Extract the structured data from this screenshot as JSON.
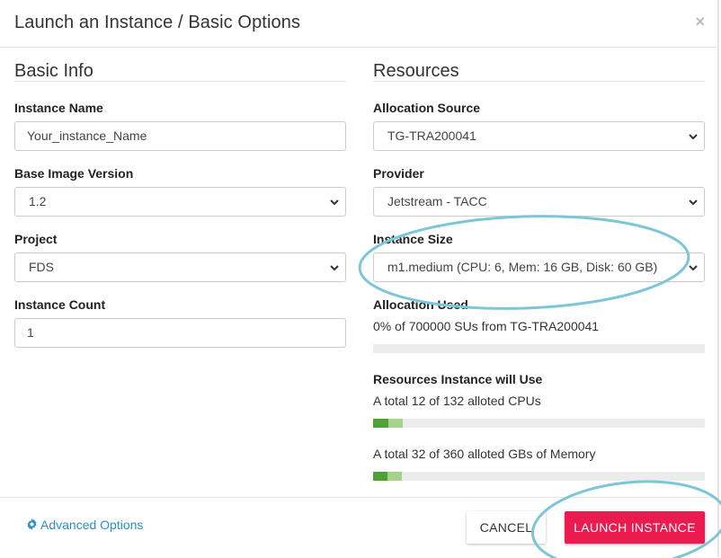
{
  "dialog": {
    "title": "Launch an Instance / Basic Options",
    "close_glyph": "×"
  },
  "basic_info": {
    "heading": "Basic Info",
    "instance_name": {
      "label": "Instance Name",
      "value": "Your_instance_Name"
    },
    "base_image_version": {
      "label": "Base Image Version",
      "value": "1.2"
    },
    "project": {
      "label": "Project",
      "value": "FDS"
    },
    "instance_count": {
      "label": "Instance Count",
      "value": "1"
    }
  },
  "resources": {
    "heading": "Resources",
    "allocation_source": {
      "label": "Allocation Source",
      "value": "TG-TRA200041"
    },
    "provider": {
      "label": "Provider",
      "value": "Jetstream - TACC"
    },
    "instance_size": {
      "label": "Instance Size",
      "value": "m1.medium (CPU: 6, Mem: 16 GB, Disk: 60 GB)"
    },
    "allocation_used": {
      "label": "Allocation Used",
      "text": "0% of 700000 SUs from TG-TRA200041",
      "fraction_used": 0.0
    },
    "instance_will_use": {
      "label": "Resources Instance will Use",
      "cpus": {
        "text": "A total 12 of 132 alloted CPUs",
        "current_fraction": 0.045,
        "added_fraction": 0.045
      },
      "memory": {
        "text": "A total 32 of 360 alloted GBs of Memory",
        "current_fraction": 0.044,
        "added_fraction": 0.044
      }
    }
  },
  "footer": {
    "advanced_options": "Advanced Options",
    "cancel": "CANCEL",
    "launch": "LAUNCH INSTANCE"
  },
  "colors": {
    "primary": "#ec1b4f",
    "link": "#2a8fc6",
    "bar_current": "#4fa232",
    "bar_added": "#a4d48c",
    "annotation": "#7cc6d8"
  },
  "icons": {
    "close": "close-icon",
    "chevron": "chevron-down-icon",
    "gear": "gear-icon"
  }
}
